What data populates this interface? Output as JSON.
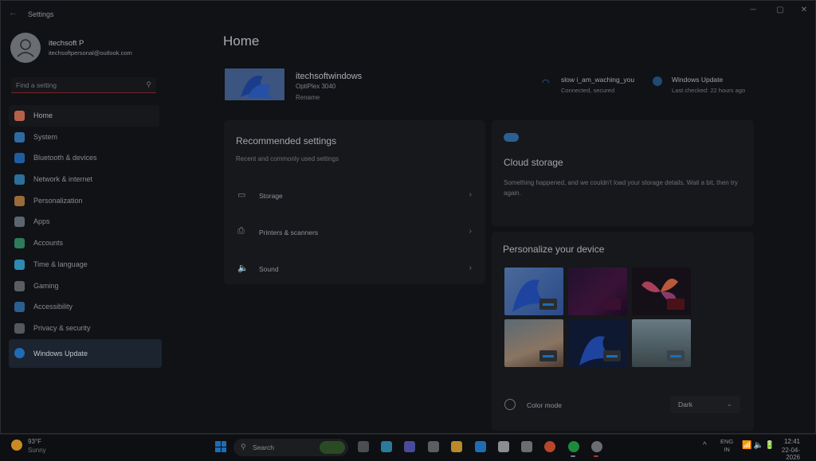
{
  "window": {
    "title": "Settings",
    "minimize": "─",
    "maximize": "▢",
    "close": "✕",
    "back": "←"
  },
  "user": {
    "name": "itechsoft P",
    "email": "itechsoftpersonal@outlook.com"
  },
  "search": {
    "placeholder": "Find a setting",
    "icon": "search-icon"
  },
  "nav": [
    {
      "label": "Home",
      "color": "#b8614a"
    },
    {
      "label": "System",
      "color": "#2f6aa3"
    },
    {
      "label": "Bluetooth & devices",
      "color": "#1f5e9e"
    },
    {
      "label": "Network & internet",
      "color": "#2c6f9a"
    },
    {
      "label": "Personalization",
      "color": "#9a6a38"
    },
    {
      "label": "Apps",
      "color": "#5c6670"
    },
    {
      "label": "Accounts",
      "color": "#2f7a5a"
    },
    {
      "label": "Time & language",
      "color": "#2f8ab0"
    },
    {
      "label": "Gaming",
      "color": "#5a5e63"
    },
    {
      "label": "Accessibility",
      "color": "#2b5f92"
    },
    {
      "label": "Privacy & security",
      "color": "#55595e"
    },
    {
      "label": "Windows Update",
      "color": "#1f6cb5"
    }
  ],
  "page_title": "Home",
  "device": {
    "name": "itechsoftwindows",
    "model": "OptiPlex 3040",
    "rename": "Rename"
  },
  "wifi": {
    "name": "slow i_am_waching_you",
    "status": "Connected, secured"
  },
  "windows_update": {
    "name": "Windows Update",
    "status": "Last checked: 22 hours ago"
  },
  "recommended": {
    "title": "Recommended settings",
    "subtitle": "Recent and commonly used settings",
    "items": [
      {
        "label": "Storage",
        "icon": "storage-icon",
        "glyph": "▭"
      },
      {
        "label": "Printers & scanners",
        "icon": "printer-icon",
        "glyph": "⎙"
      },
      {
        "label": "Sound",
        "icon": "speaker-icon",
        "glyph": "🔈"
      }
    ],
    "chevron": "›"
  },
  "cloud": {
    "title": "Cloud storage",
    "message": "Something happened, and we couldn't load your storage details. Wait a bit, then try again."
  },
  "personalize": {
    "title": "Personalize your device",
    "color_mode_label": "Color mode",
    "color_mode_value": "Dark",
    "chevron": "⌄"
  },
  "taskbar": {
    "weather_temp": "93°F",
    "weather_desc": "Sunny",
    "search_label": "Search",
    "lang_1": "ENG",
    "lang_2": "IN",
    "time": "12:41",
    "date": "22-04-2026",
    "tray_chevron": "^",
    "tray_icons": "📶🔈🔋",
    "search_icon": "⚲"
  }
}
